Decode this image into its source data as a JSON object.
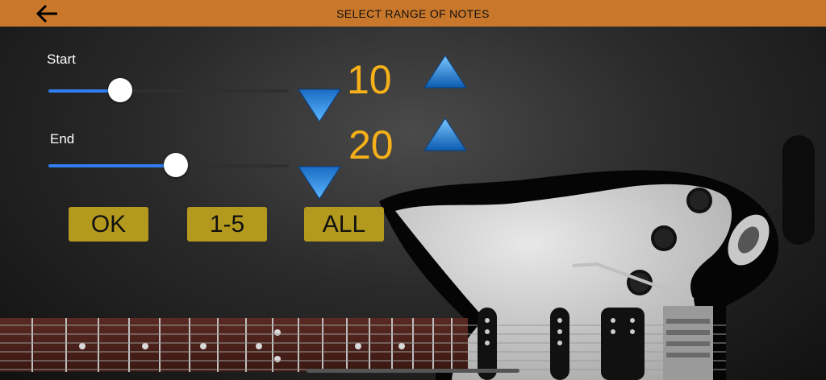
{
  "header": {
    "title": "SELECT RANGE OF NOTES",
    "back_icon": "arrow-left-icon"
  },
  "start": {
    "label": "Start",
    "value": "10",
    "slider_fraction": 0.3
  },
  "end": {
    "label": "End",
    "value": "20",
    "slider_fraction": 0.53
  },
  "buttons": {
    "ok": "OK",
    "range": "1-5",
    "all": "ALL"
  },
  "colors": {
    "header": "#c9772a",
    "accent": "#2f7df0",
    "number": "#f5b01a",
    "button": "#b39a1e"
  }
}
